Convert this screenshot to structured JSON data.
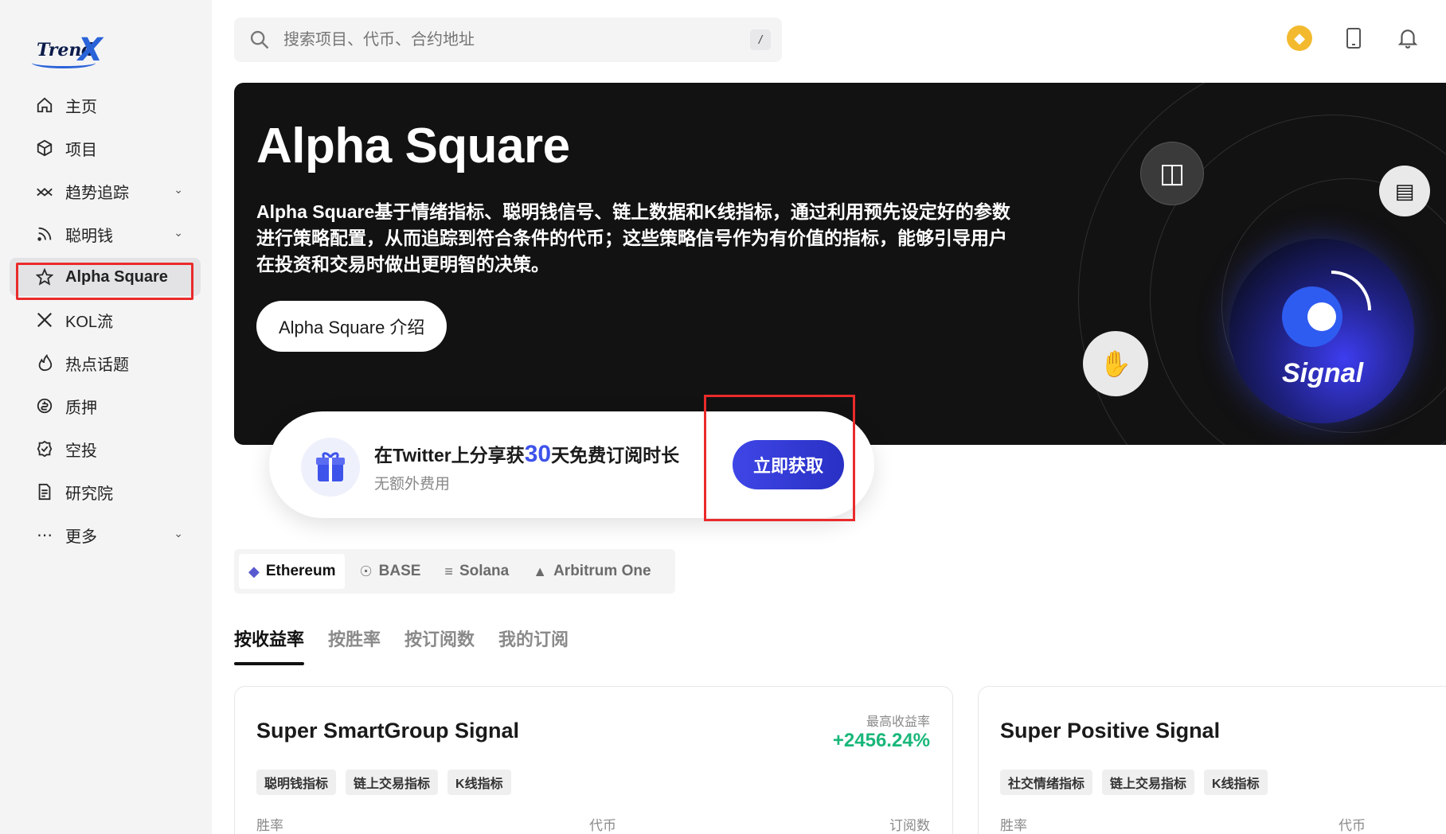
{
  "brand": {
    "logo_text": "Trend",
    "logo_x": "X"
  },
  "sidebar": {
    "items": [
      {
        "label": "主页",
        "icon": "home-icon",
        "has_chevron": false
      },
      {
        "label": "项目",
        "icon": "cube-icon",
        "has_chevron": false
      },
      {
        "label": "趋势追踪",
        "icon": "trend-icon",
        "has_chevron": true
      },
      {
        "label": "聪明钱",
        "icon": "rss-icon",
        "has_chevron": true
      },
      {
        "label": "Alpha Square",
        "icon": "star-icon",
        "has_chevron": false,
        "active": true
      },
      {
        "label": "KOL流",
        "icon": "x-logo-icon",
        "has_chevron": false
      },
      {
        "label": "热点话题",
        "icon": "flame-icon",
        "has_chevron": false
      },
      {
        "label": "质押",
        "icon": "stake-icon",
        "has_chevron": false
      },
      {
        "label": "空投",
        "icon": "badge-check-icon",
        "has_chevron": false
      },
      {
        "label": "研究院",
        "icon": "document-icon",
        "has_chevron": false
      },
      {
        "label": "更多",
        "icon": "more-dots-icon",
        "has_chevron": true
      }
    ]
  },
  "search": {
    "placeholder": "搜索项目、代币、合约地址",
    "shortcut": "/"
  },
  "topbar": {
    "icons": [
      "bnb-chain-icon",
      "mobile-icon",
      "bell-icon"
    ],
    "bnb_color": "#f3ba2f"
  },
  "hero": {
    "title": "Alpha Square",
    "description": "Alpha Square基于情绪指标、聪明钱信号、链上数据和K线指标，通过利用预先设定好的参数进行策略配置，从而追踪到符合条件的代币；这些策略信号作为有价值的指标，能够引导用户在投资和交易时做出更明智的决策。",
    "button_label": "Alpha Square 介绍",
    "graphic_label": "Signal"
  },
  "promo": {
    "title_before": "在Twitter上分享获",
    "title_number": "30",
    "title_after": "天免费订阅时长",
    "subtitle": "无额外费用",
    "button_label": "立即获取",
    "accent": "#3e53ea"
  },
  "chains": [
    {
      "label": "Ethereum",
      "icon": "ethereum-icon",
      "active": true
    },
    {
      "label": "BASE",
      "icon": "base-icon",
      "active": false
    },
    {
      "label": "Solana",
      "icon": "solana-icon",
      "active": false
    },
    {
      "label": "Arbitrum One",
      "icon": "arbitrum-icon",
      "active": false
    }
  ],
  "sort_tabs": [
    {
      "label": "按收益率",
      "active": true
    },
    {
      "label": "按胜率",
      "active": false
    },
    {
      "label": "按订阅数",
      "active": false
    },
    {
      "label": "我的订阅",
      "active": false
    }
  ],
  "cards": [
    {
      "title": "Super SmartGroup Signal",
      "rate_label": "最高收益率",
      "rate_value": "+2456.24%",
      "tags": [
        "聪明钱指标",
        "链上交易指标",
        "K线指标"
      ],
      "columns": [
        "胜率",
        "代币",
        "订阅数"
      ]
    },
    {
      "title": "Super Positive Signal",
      "rate_label": "",
      "rate_value": "",
      "tags": [
        "社交情绪指标",
        "链上交易指标",
        "K线指标"
      ],
      "columns": [
        "胜率",
        "代币"
      ]
    }
  ],
  "colors": {
    "positive": "#19b77a",
    "annotation": "#ea2b2b",
    "hero_bg": "#121212"
  }
}
